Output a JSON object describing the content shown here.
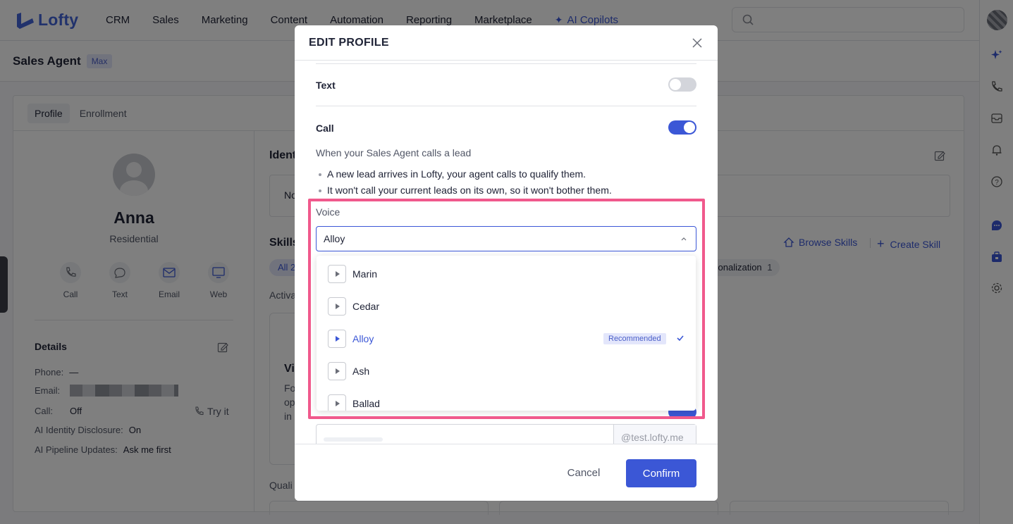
{
  "app": {
    "logo_text": "Lofty",
    "nav": [
      "CRM",
      "Sales",
      "Marketing",
      "Content",
      "Automation",
      "Reporting",
      "Marketplace"
    ],
    "ai_nav": "AI Copilots"
  },
  "page": {
    "title": "Sales Agent",
    "badge": "Max",
    "tabs": [
      "Profile",
      "Enrollment"
    ]
  },
  "profile": {
    "name": "Anna",
    "role": "Residential",
    "actions": [
      "Call",
      "Text",
      "Email",
      "Web"
    ],
    "details_title": "Details",
    "details": {
      "phone_label": "Phone:",
      "phone_value": "—",
      "email_label": "Email:",
      "call_label": "Call:",
      "call_value": "Off",
      "try_it": "Try it",
      "disclosure_label": "AI Identity Disclosure:",
      "disclosure_value": "On",
      "pipeline_label": "AI Pipeline Updates:",
      "pipeline_value": "Ask me first"
    }
  },
  "right": {
    "identity_title": "Ident",
    "identity_box": "No",
    "skills_title": "Skills",
    "browse_skills": "Browse Skills",
    "create_skill": "Create Skill",
    "chip_all": "All 2",
    "chip_pers": "sonalization",
    "chip_pers_count": "1",
    "active": "Activa",
    "card_title": "Vi",
    "card_lines": [
      "Fo",
      "op",
      "in"
    ],
    "qualify": "Quali"
  },
  "modal": {
    "title": "EDIT PROFILE",
    "text_label": "Text",
    "text_enabled": false,
    "call_label": "Call",
    "call_enabled": true,
    "call_desc": "When your Sales Agent calls a lead",
    "bullets": [
      "A new lead arrives in Lofty, your agent calls to qualify them.",
      "It won't call your current leads on its own, so it won't bother them."
    ],
    "voice_label": "Voice",
    "voice_selected": "Alloy",
    "voice_options": [
      {
        "name": "Marin",
        "recommended": false,
        "selected": false
      },
      {
        "name": "Cedar",
        "recommended": false,
        "selected": false
      },
      {
        "name": "Alloy",
        "recommended": true,
        "selected": true
      },
      {
        "name": "Ash",
        "recommended": false,
        "selected": false
      },
      {
        "name": "Ballad",
        "recommended": false,
        "selected": false
      }
    ],
    "recommended_tag": "Recommended",
    "email_suffix": "@test.lofty.me",
    "cancel": "Cancel",
    "confirm": "Confirm"
  },
  "colors": {
    "accent": "#3b57d6",
    "highlight": "#f0598c"
  }
}
